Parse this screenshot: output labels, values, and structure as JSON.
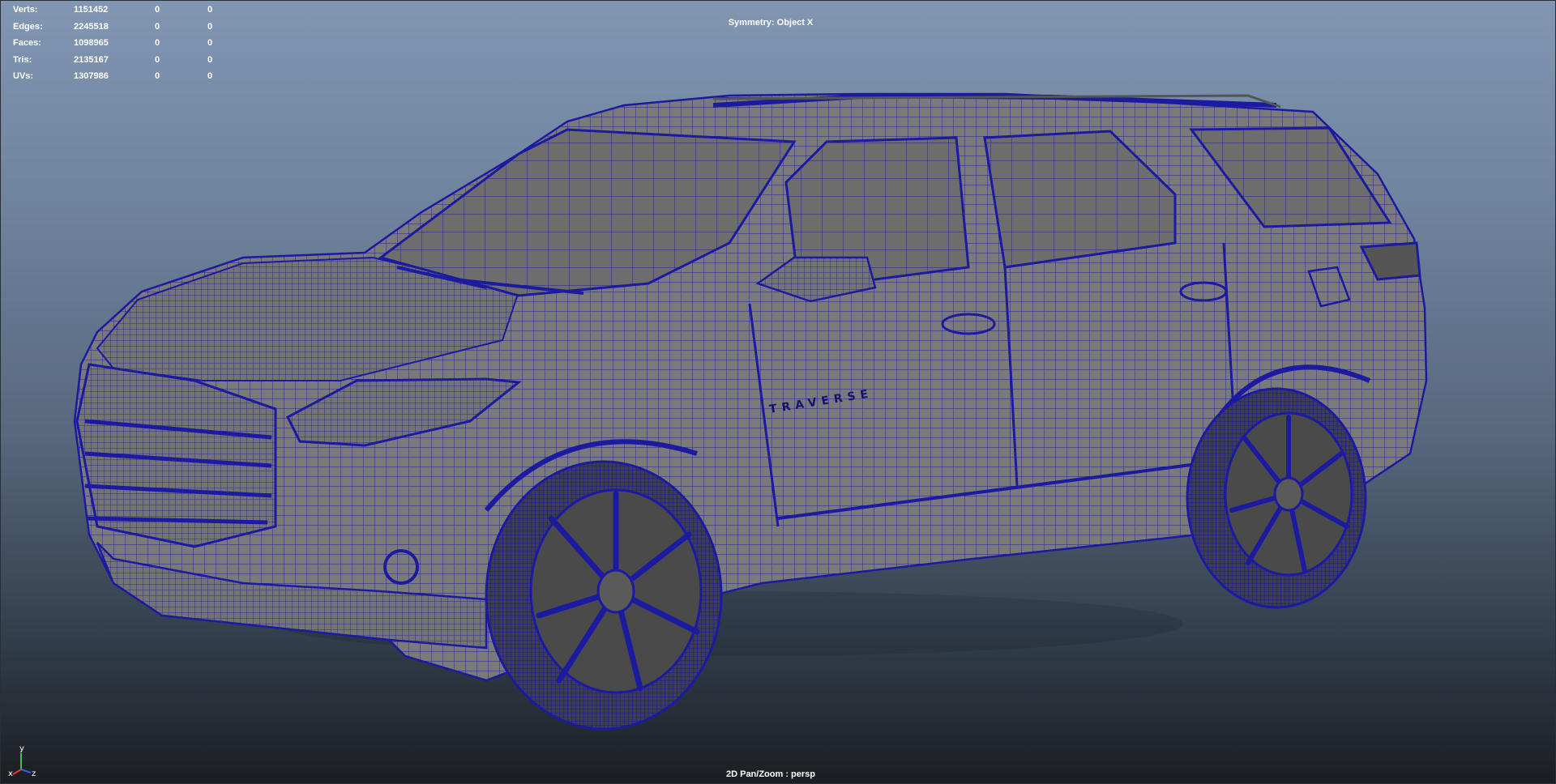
{
  "heads_up": {
    "rows": [
      {
        "label": "Verts:",
        "total": "1151452",
        "selected": "0",
        "component": "0"
      },
      {
        "label": "Edges:",
        "total": "2245518",
        "selected": "0",
        "component": "0"
      },
      {
        "label": "Faces:",
        "total": "1098965",
        "selected": "0",
        "component": "0"
      },
      {
        "label": "Tris:",
        "total": "2135167",
        "selected": "0",
        "component": "0"
      },
      {
        "label": "UVs:",
        "total": "1307986",
        "selected": "0",
        "component": "0"
      }
    ]
  },
  "symmetry_label": "Symmetry: Object X",
  "camera_label": "2D Pan/Zoom : persp",
  "model": {
    "badge_text": "TRAVERSE",
    "wire_color": "#1b1aa0",
    "surface_color": "#7a7a7a"
  },
  "axis_gizmo": {
    "x": "x",
    "y": "y",
    "z": "z"
  },
  "colors": {
    "grad_top": "#8196b2",
    "grad_bottom": "#1b1e22",
    "hud_text": "#ffffff"
  }
}
